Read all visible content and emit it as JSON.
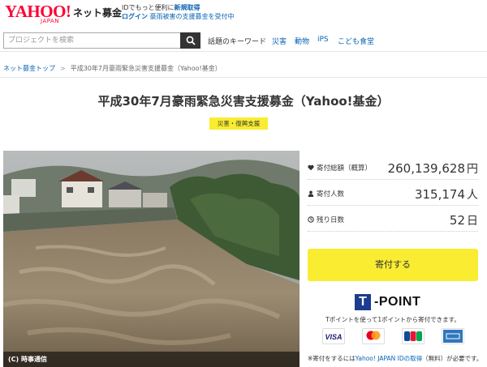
{
  "header": {
    "logo_text": "YAHOO!",
    "logo_sub": "JAPAN",
    "service_name": "ネット募金",
    "info_line1_prefix": "IDでもっと便利に",
    "info_line1_link": "新規取得",
    "info_line2_login": "ログイン",
    "info_line2_text": "豪雨被害の支援募金を受付中"
  },
  "search": {
    "placeholder": "プロジェクトを検索",
    "keywords_label": "話題のキーワード",
    "keywords": [
      "災害",
      "動物",
      "iPS",
      "こども食堂"
    ]
  },
  "breadcrumb": {
    "home": "ネット募金トップ",
    "separator": ">",
    "current": "平成30年7月豪雨緊急災害支援募金（Yahoo!基金）"
  },
  "page": {
    "title": "平成30年7月豪雨緊急災害支援募金（Yahoo!基金）",
    "tag": "災害・復興支援"
  },
  "photo": {
    "credit": "(C) 時事通信"
  },
  "stats": {
    "total_label": "寄付総額（概算）",
    "total_value": "260,139,628",
    "total_unit": "円",
    "donors_label": "寄付人数",
    "donors_value": "315,174",
    "donors_unit": "人",
    "days_label": "残り日数",
    "days_value": "52",
    "days_unit": "日"
  },
  "donate": {
    "button_label": "寄付する"
  },
  "tpoint": {
    "logo_t": "T",
    "logo_text": "-POINT",
    "description": "Tポイントを使って1ポイントから寄付できます。",
    "cards": [
      "VISA",
      "Mastercard",
      "JCB",
      "AMERICAN EXPRESS"
    ]
  },
  "note": {
    "prefix": "※寄付をするには",
    "link": "Yahoo! JAPAN IDの取得",
    "suffix": "（無料）が必要です。"
  },
  "colors": {
    "brand_red": "#ff0033",
    "accent_yellow": "#f9ec31",
    "link_blue": "#0a64b4",
    "tpoint_blue": "#1b3c8f"
  }
}
